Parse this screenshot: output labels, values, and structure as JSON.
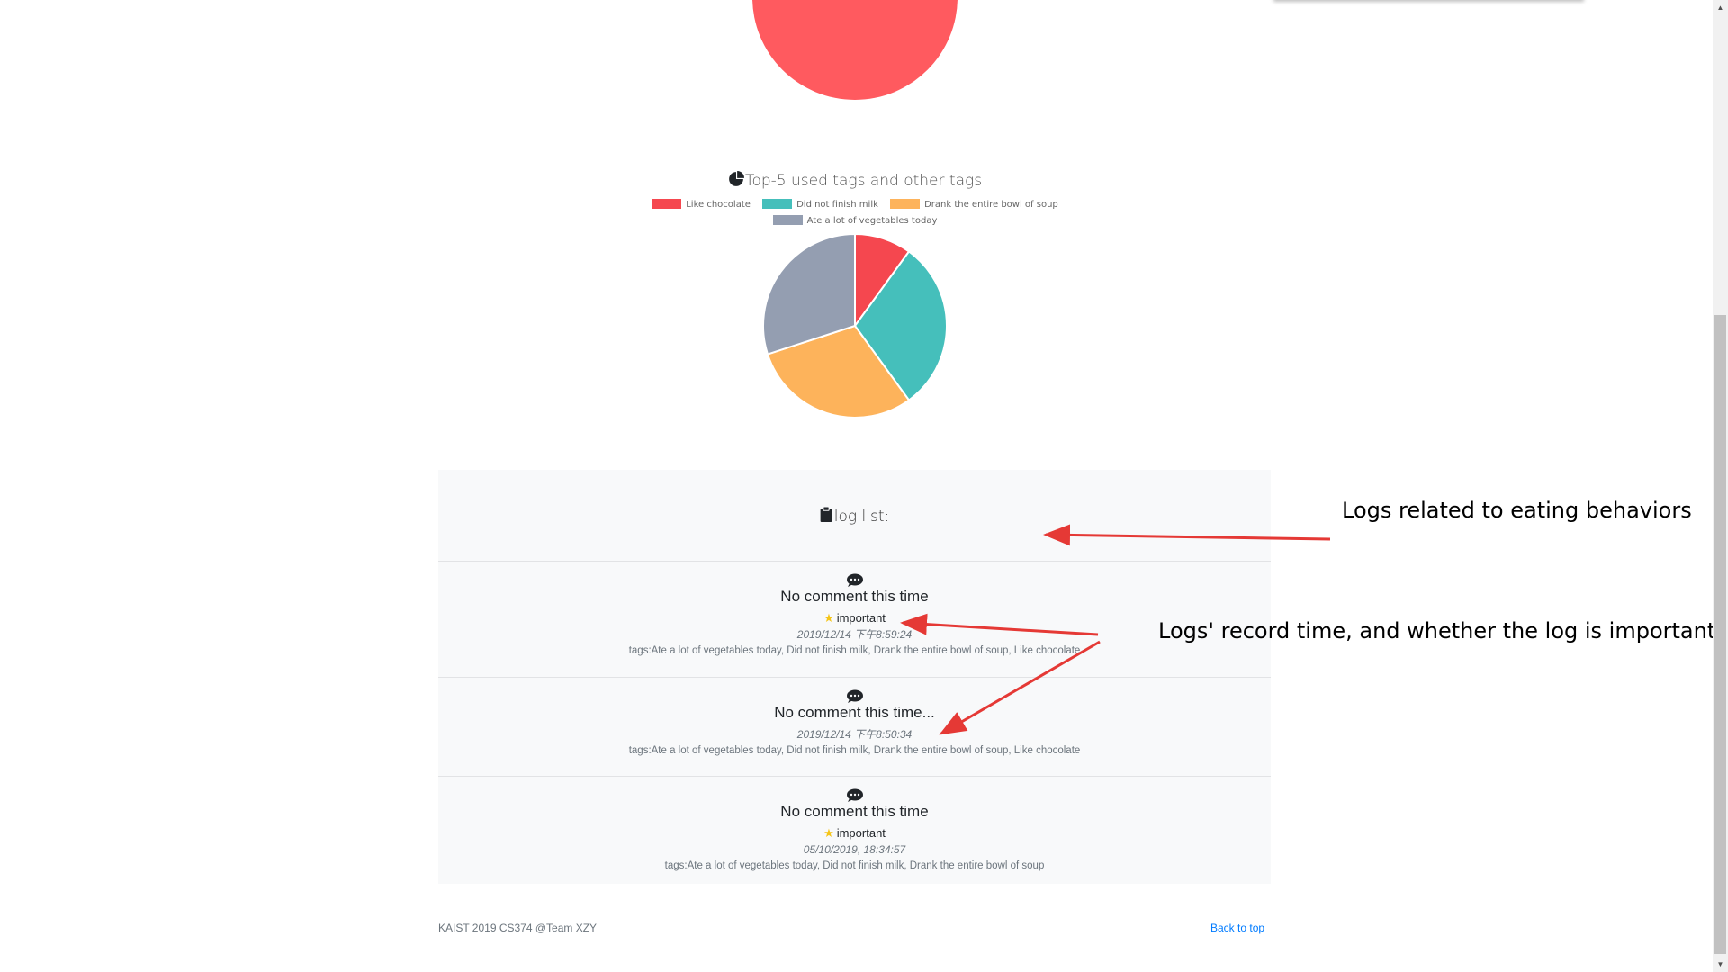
{
  "top_chart": {
    "color": "#ff5a5f"
  },
  "tags_chart": {
    "title": "Top-5 used tags and other tags",
    "legend": [
      {
        "label": "Like chocolate",
        "color": "#f5474f"
      },
      {
        "label": "Did not finish milk",
        "color": "#45bfbb"
      },
      {
        "label": "Drank the entire bowl of soup",
        "color": "#fdb35b"
      },
      {
        "label": "Ate a lot of vegetables today",
        "color": "#949eb1"
      }
    ]
  },
  "chart_data": {
    "type": "pie",
    "title": "Top-5 used tags and other tags",
    "labels": [
      "Like chocolate",
      "Did not finish milk",
      "Drank the entire bowl of soup",
      "Ate a lot of vegetables today"
    ],
    "values": [
      10,
      30,
      30,
      30
    ],
    "colors": [
      "#f5474f",
      "#45bfbb",
      "#fdb35b",
      "#949eb1"
    ],
    "legend_position": "top"
  },
  "log_list": {
    "header": "log list:",
    "items": [
      {
        "comment": "No comment this time",
        "important": "important",
        "time": "2019/12/14 下午8:59:24",
        "tags": "tags:Ate a lot of vegetables today, Did not finish milk, Drank the entire bowl of soup, Like chocolate"
      },
      {
        "comment": "No comment this time...",
        "important": null,
        "time": "2019/12/14 下午8:50:34",
        "tags": "tags:Ate a lot of vegetables today, Did not finish milk, Drank the entire bowl of soup, Like chocolate"
      },
      {
        "comment": "No comment this time",
        "important": "important",
        "time": "05/10/2019, 18:34:57",
        "tags": "tags:Ate a lot of vegetables today, Did not finish milk, Drank the entire bowl of soup"
      }
    ]
  },
  "footer": {
    "text": "KAIST 2019 CS374 @Team XZY",
    "back_to_top": "Back to top",
    "link_color": "#007bff"
  },
  "annotations": {
    "log_list_note": "Logs related to eating behaviors",
    "record_time_note": "Logs' record time, and whether the log is important.",
    "arrow_color": "#e53935"
  }
}
